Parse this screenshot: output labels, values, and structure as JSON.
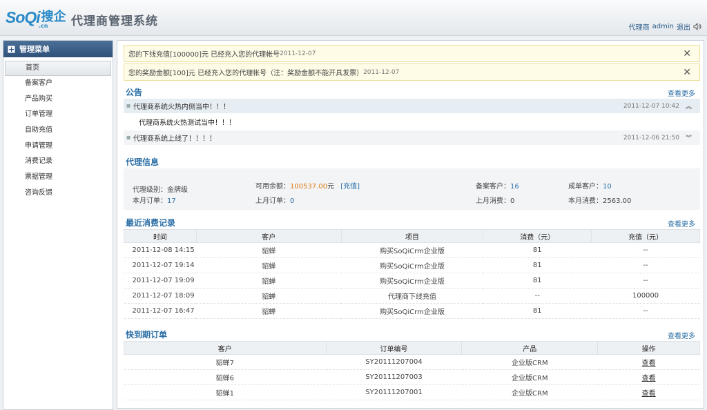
{
  "header": {
    "logo_so": "SoQi",
    "logo_cn": ".cn",
    "logo_cnname": "搜企",
    "title": "代理商管理系统",
    "user_role": "代理商",
    "user_name": "admin",
    "logout": "退出"
  },
  "sidebar": {
    "title": "管理菜单",
    "items": [
      {
        "label": "首页"
      },
      {
        "label": "备案客户"
      },
      {
        "label": "产品购买"
      },
      {
        "label": "订单管理"
      },
      {
        "label": "自助充值"
      },
      {
        "label": "申请管理"
      },
      {
        "label": "消费记录"
      },
      {
        "label": "票据管理"
      },
      {
        "label": "咨询反馈"
      }
    ]
  },
  "notices": [
    {
      "text": "您的下线充值[100000]元 已经充入您的代理帐号",
      "date": "2011-12-07"
    },
    {
      "text": "您的奖励金额[100]元 已经充入您的代理帐号（注：奖励金额不能开具发票）",
      "date": "2011-12-07"
    }
  ],
  "announcements": {
    "title": "公告",
    "more": "查看更多",
    "items": [
      {
        "title": "代理商系统火热内侧当中！！！",
        "date": "2011-12-07 10:42",
        "body": "代理商系统火热测试当中！！！"
      },
      {
        "title": "代理商系统上线了！！！！",
        "date": "2011-12-06 21:50"
      }
    ]
  },
  "agent_info": {
    "title": "代理信息",
    "level_label": "代理级别：",
    "level": "金牌级",
    "balance_label": "可用余额：",
    "balance": "100537.00",
    "balance_unit": "元",
    "recharge": "[充值]",
    "filed_customers_label": "备案客户：",
    "filed_customers": "16",
    "deal_customers_label": "成单客户：",
    "deal_customers": "10",
    "month_orders_label": "本月订单：",
    "month_orders": "17",
    "last_month_orders_label": "上月订单：",
    "last_month_orders": "0",
    "last_month_spend_label": "上月消费：",
    "last_month_spend": "0",
    "month_spend_label": "本月消费：",
    "month_spend": "2563.00"
  },
  "consumption": {
    "title": "最近消费记录",
    "more": "查看更多",
    "headers": [
      "时间",
      "客户",
      "项目",
      "消费（元）",
      "充值（元）"
    ],
    "rows": [
      [
        "2011-12-08 14:15",
        "貂蝉",
        "购买SoQiCrm企业版",
        "81",
        "--"
      ],
      [
        "2011-12-07 19:14",
        "貂蝉",
        "购买SoQiCrm企业版",
        "81",
        "--"
      ],
      [
        "2011-12-07 19:09",
        "貂蝉",
        "购买SoQiCrm企业版",
        "81",
        "--"
      ],
      [
        "2011-12-07 18:09",
        "貂蝉",
        "代理商下线充值",
        "--",
        "100000"
      ],
      [
        "2011-12-07 16:47",
        "貂蝉",
        "购买SoQiCrm企业版",
        "81",
        "--"
      ]
    ]
  },
  "expiring_orders": {
    "title": "快到期订单",
    "more": "查看更多",
    "headers": [
      "客户",
      "订单编号",
      "产品",
      "操作"
    ],
    "rows": [
      [
        "貂蝉7",
        "SY20111207004",
        "企业版CRM",
        "查看"
      ],
      [
        "貂蝉6",
        "SY20111207003",
        "企业版CRM",
        "查看"
      ],
      [
        "貂蝉1",
        "SY20111207001",
        "企业版CRM",
        "查看"
      ]
    ]
  }
}
